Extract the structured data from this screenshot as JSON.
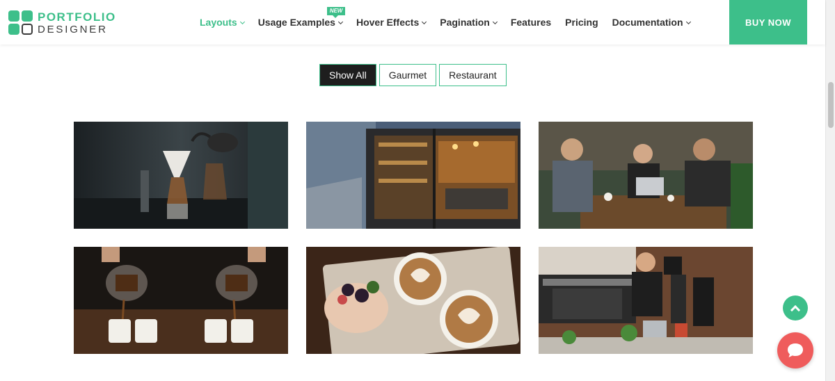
{
  "brand": {
    "line1": "PORTFOLIO",
    "line2": "DESIGNER",
    "color": "#3dbf8a"
  },
  "nav": {
    "items": [
      {
        "label": "Layouts",
        "dropdown": true,
        "active": true
      },
      {
        "label": "Usage Examples",
        "dropdown": true,
        "badge": "NEW"
      },
      {
        "label": "Hover Effects",
        "dropdown": true
      },
      {
        "label": "Pagination",
        "dropdown": true
      },
      {
        "label": "Features",
        "dropdown": false
      },
      {
        "label": "Pricing",
        "dropdown": false
      },
      {
        "label": "Documentation",
        "dropdown": true
      }
    ],
    "buy_label": "BUY NOW"
  },
  "filters": [
    {
      "label": "Show All",
      "active": true
    },
    {
      "label": "Gaurmet",
      "active": false
    },
    {
      "label": "Restaurant",
      "active": false
    }
  ],
  "gallery": [
    {
      "name": "coffee-brewing-image",
      "subject": "pour-over coffee brewing"
    },
    {
      "name": "cafe-storefront-image",
      "subject": "cafe storefront with bookshelves"
    },
    {
      "name": "friends-cafe-image",
      "subject": "friends at cafe table with laptop"
    },
    {
      "name": "pouring-coffee-image",
      "subject": "pouring coffee into cups"
    },
    {
      "name": "latte-art-image",
      "subject": "latte art cups with dessert"
    },
    {
      "name": "barista-image",
      "subject": "barista at espresso machine"
    }
  ],
  "floating": {
    "scroll_top_icon": "chevron-up-icon",
    "chat_icon": "chat-bubble-icon"
  },
  "colors": {
    "accent": "#3dbf8a",
    "chat": "#ef5c5c",
    "dark": "#1e1e1e"
  }
}
